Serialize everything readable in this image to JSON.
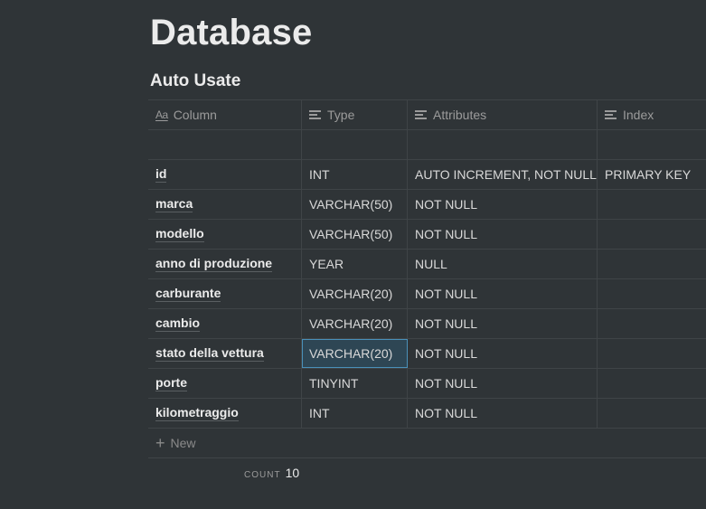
{
  "page": {
    "title": "Database"
  },
  "database": {
    "title": "Auto Usate",
    "columns": {
      "column": "Column",
      "type": "Type",
      "attributes": "Attributes",
      "index": "Index"
    },
    "rows": [
      {
        "column": "",
        "type": "",
        "attributes": "",
        "index": ""
      },
      {
        "column": "id",
        "type": "INT",
        "attributes": "AUTO INCREMENT, NOT NULL",
        "index": "PRIMARY KEY"
      },
      {
        "column": "marca",
        "type": "VARCHAR(50)",
        "attributes": "NOT NULL",
        "index": ""
      },
      {
        "column": "modello",
        "type": "VARCHAR(50)",
        "attributes": "NOT NULL",
        "index": ""
      },
      {
        "column": "anno di produzione",
        "type": "YEAR",
        "attributes": "NULL",
        "index": ""
      },
      {
        "column": "carburante",
        "type": "VARCHAR(20)",
        "attributes": "NOT NULL",
        "index": ""
      },
      {
        "column": "cambio",
        "type": "VARCHAR(20)",
        "attributes": "NOT NULL",
        "index": ""
      },
      {
        "column": "stato della vettura",
        "type": "VARCHAR(20)",
        "attributes": "NOT NULL",
        "index": ""
      },
      {
        "column": "porte",
        "type": "TINYINT",
        "attributes": "NOT NULL",
        "index": ""
      },
      {
        "column": "kilometraggio",
        "type": "INT",
        "attributes": "NOT NULL",
        "index": ""
      }
    ],
    "new_label": "New",
    "count_label": "COUNT",
    "count_value": "10"
  },
  "icons": {
    "title_column": "text-aa-icon",
    "text_property": "lines-icon",
    "add": "plus-icon"
  }
}
